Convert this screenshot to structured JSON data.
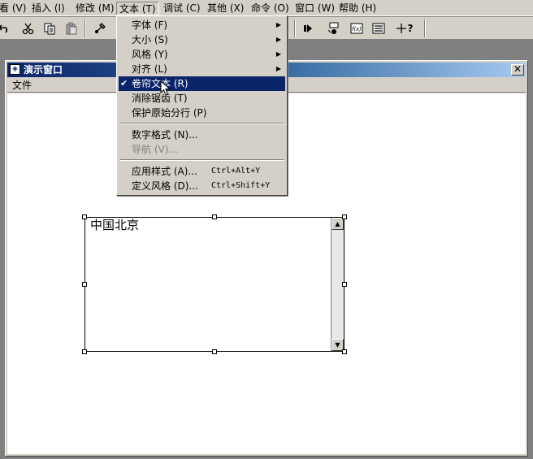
{
  "menubar": {
    "items": [
      {
        "label": "看 (V)"
      },
      {
        "label": "插入 (I)"
      },
      {
        "label": "修改 (M)"
      },
      {
        "label": "文本 (T)"
      },
      {
        "label": "调试 (C)"
      },
      {
        "label": "其他 (X)"
      },
      {
        "label": "命令 (O)"
      },
      {
        "label": "窗口 (W)"
      },
      {
        "label": "帮助 (H)"
      }
    ],
    "active_item": "文本 (T)"
  },
  "toolbar": {
    "icons": [
      "undo-icon",
      "cut-icon",
      "copy-icon",
      "paste-icon",
      "tool-icon",
      "step-icon",
      "trace-icon",
      "function-icon",
      "list-icon",
      "help-cursor-icon"
    ]
  },
  "window": {
    "title": "演示窗口",
    "close_glyph": "✕",
    "menu_file": "文件"
  },
  "text_field": {
    "text": "中国北京"
  },
  "dropdown": {
    "items": [
      {
        "label": "字体 (F)",
        "submenu": true
      },
      {
        "label": "大小 (S)",
        "submenu": true
      },
      {
        "label": "风格 (Y)",
        "submenu": true
      },
      {
        "label": "对齐 (L)",
        "submenu": true
      },
      {
        "label": "卷帘文本 (R)",
        "checked": true,
        "highlighted": true
      },
      {
        "label": "消除锯齿 (T)"
      },
      {
        "label": "保护原始分行 (P)"
      },
      {
        "label": "数字格式 (N)..."
      },
      {
        "label": "导航 (V)...",
        "disabled": true
      },
      {
        "label": "应用样式 (A)...",
        "shortcut": "Ctrl+Alt+Y"
      },
      {
        "label": "定义风格 (D)...",
        "shortcut": "Ctrl+Shift+Y"
      }
    ],
    "check_glyph": "✔",
    "arrow_glyph": "▶"
  },
  "colors": {
    "face": "#d4d0c8",
    "highlight": "#0a246a",
    "title_start": "#0a246a",
    "title_end": "#a6caf0"
  }
}
